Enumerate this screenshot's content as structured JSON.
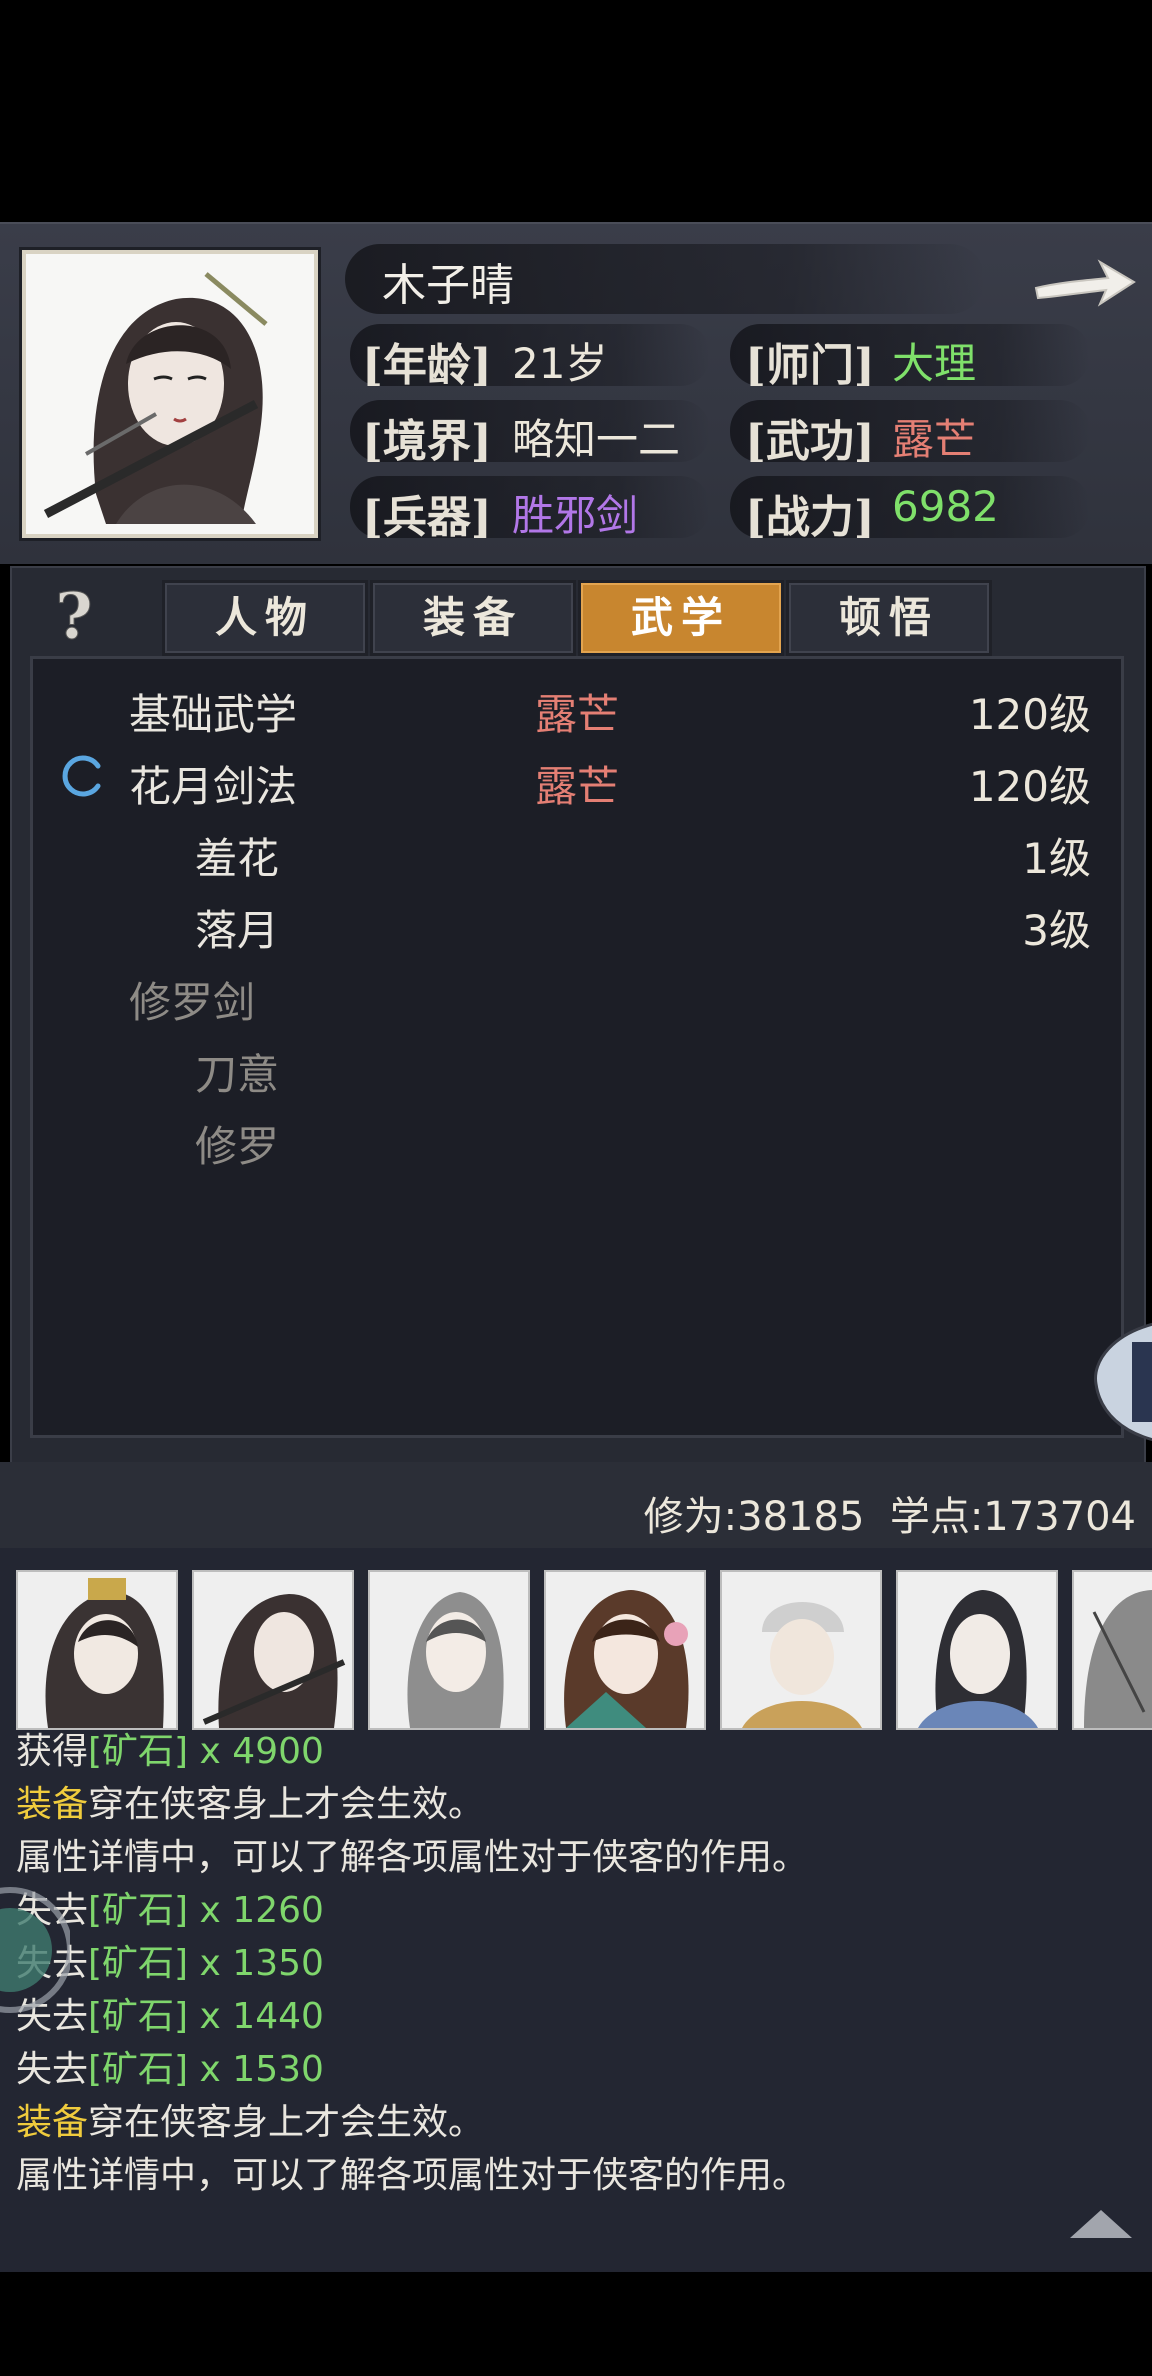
{
  "character": {
    "name": "木子晴",
    "attributes": [
      {
        "key": "[年龄]",
        "value": "21岁",
        "color": "#ece7db"
      },
      {
        "key": "[师门]",
        "value": "大理",
        "color": "#7fe06a"
      },
      {
        "key": "[境界]",
        "value": "略知一二",
        "color": "#ece7db"
      },
      {
        "key": "[武功]",
        "value": "露芒",
        "color": "#e47f74"
      },
      {
        "key": "[兵器]",
        "value": "胜邪剑",
        "color": "#b277e8"
      },
      {
        "key": "[战力]",
        "value": "6982",
        "color": "#7fe06a"
      }
    ]
  },
  "tabs": [
    {
      "label": "人物",
      "active": false
    },
    {
      "label": "装备",
      "active": false
    },
    {
      "label": "武学",
      "active": true
    },
    {
      "label": "顿悟",
      "active": false
    }
  ],
  "skills": [
    {
      "name": "基础武学",
      "style": "露芒",
      "level": "120级",
      "indent": 0,
      "dim": false
    },
    {
      "name": "花月剑法",
      "style": "露芒",
      "level": "120级",
      "indent": 0,
      "dim": false
    },
    {
      "name": "羞花",
      "style": "",
      "level": "1级",
      "indent": 1,
      "dim": false
    },
    {
      "name": "落月",
      "style": "",
      "level": "3级",
      "indent": 1,
      "dim": false
    },
    {
      "name": "修罗剑",
      "style": "",
      "level": "",
      "indent": 0,
      "dim": true
    },
    {
      "name": "刀意",
      "style": "",
      "level": "",
      "indent": 1,
      "dim": true
    },
    {
      "name": "修罗",
      "style": "",
      "level": "",
      "indent": 1,
      "dim": true
    }
  ],
  "stats": {
    "text": "修为:38185  学点:173704"
  },
  "log": [
    [
      {
        "t": "获得",
        "c": ""
      },
      {
        "t": "[矿石]",
        "c": "g"
      },
      {
        "t": " x 4900",
        "c": "g"
      }
    ],
    [
      {
        "t": "装备",
        "c": "y"
      },
      {
        "t": "穿在侠客身上才会生效。",
        "c": ""
      }
    ],
    [
      {
        "t": "属性详情中，可以了解各项属性对于侠客的作用。",
        "c": ""
      }
    ],
    [
      {
        "t": "失去",
        "c": ""
      },
      {
        "t": "[矿石]",
        "c": "g"
      },
      {
        "t": " x 1260",
        "c": "g"
      }
    ],
    [
      {
        "t": "失去",
        "c": ""
      },
      {
        "t": "[矿石]",
        "c": "g"
      },
      {
        "t": " x 1350",
        "c": "g"
      }
    ],
    [
      {
        "t": "失去",
        "c": ""
      },
      {
        "t": "[矿石]",
        "c": "g"
      },
      {
        "t": " x 1440",
        "c": "g"
      }
    ],
    [
      {
        "t": "失去",
        "c": ""
      },
      {
        "t": "[矿石]",
        "c": "g"
      },
      {
        "t": " x 1530",
        "c": "g"
      }
    ],
    [
      {
        "t": "装备",
        "c": "y"
      },
      {
        "t": "穿在侠客身上才会生效。",
        "c": ""
      }
    ],
    [
      {
        "t": "属性详情中，可以了解各项属性对于侠客的作用。",
        "c": ""
      }
    ]
  ],
  "icons": {
    "next": "arrow-right-icon",
    "help": "question-mark-icon",
    "loading": "loading-spinner-icon",
    "scroll_up": "triangle-up-icon"
  }
}
